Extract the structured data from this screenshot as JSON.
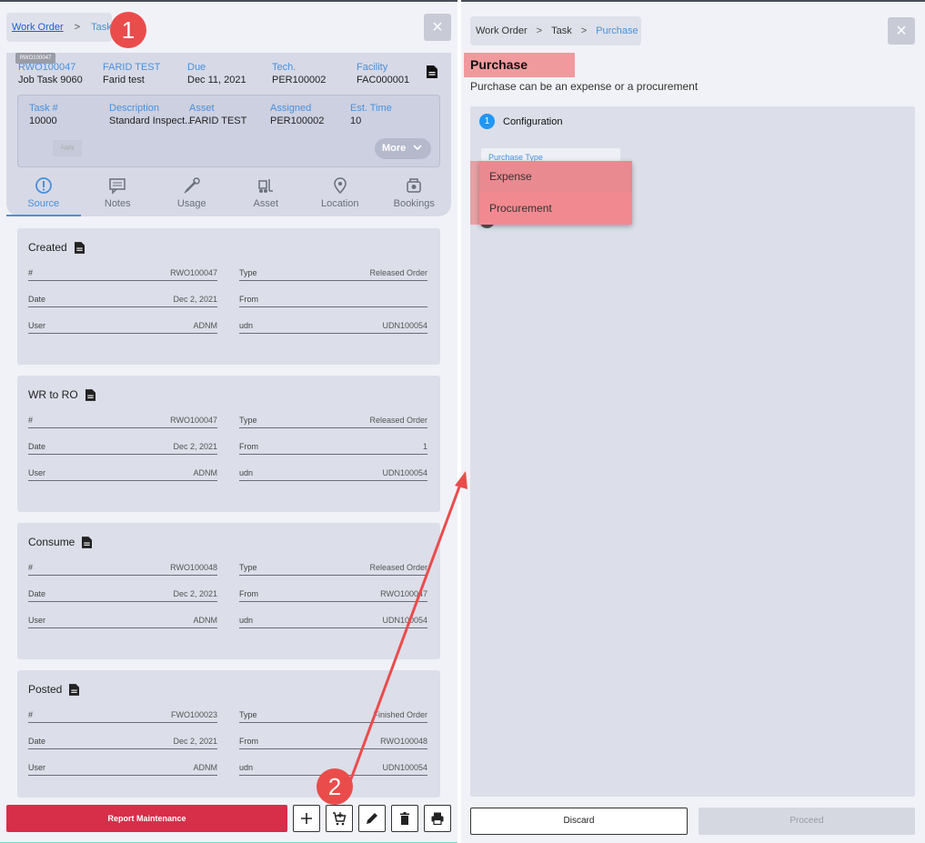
{
  "left": {
    "breadcrumb": {
      "work_order": "Work Order",
      "sep": ">",
      "task": "Task"
    },
    "close_label": "×",
    "small_tag": "RWO100047",
    "header": [
      {
        "key": "RWO100047",
        "value": "Job Task 9060"
      },
      {
        "key": "FARID TEST",
        "value": "Farid test"
      },
      {
        "key": "Due",
        "value": "Dec 11, 2021"
      },
      {
        "key": "Tech.",
        "value": "PER100002"
      },
      {
        "key": "Facility",
        "value": "FAC000001"
      }
    ],
    "inner": [
      {
        "key": "Task #",
        "value": "10000"
      },
      {
        "key": "Description",
        "value": "Standard Inspect..."
      },
      {
        "key": "Asset",
        "value": "FARID TEST"
      },
      {
        "key": "Assigned",
        "value": "PER100002"
      },
      {
        "key": "Est. Time",
        "value": "10"
      }
    ],
    "ghost_label": "Apply",
    "more_label": "More",
    "tabs": [
      {
        "label": "Source",
        "icon": "alert-circle-icon"
      },
      {
        "label": "Notes",
        "icon": "notes-icon"
      },
      {
        "label": "Usage",
        "icon": "usage-icon"
      },
      {
        "label": "Asset",
        "icon": "forklift-icon"
      },
      {
        "label": "Location",
        "icon": "location-pin-icon"
      },
      {
        "label": "Bookings",
        "icon": "bookings-icon"
      }
    ],
    "cards": [
      {
        "title": "Created",
        "rows": [
          {
            "k1": "#",
            "v1": "RWO100047",
            "k2": "Type",
            "v2": "Released Order"
          },
          {
            "k1": "Date",
            "v1": "Dec 2, 2021",
            "k2": "From",
            "v2": ""
          },
          {
            "k1": "User",
            "v1": "ADNM",
            "k2": "udn",
            "v2": "UDN100054"
          }
        ]
      },
      {
        "title": "WR to RO",
        "rows": [
          {
            "k1": "#",
            "v1": "RWO100047",
            "k2": "Type",
            "v2": "Released Order"
          },
          {
            "k1": "Date",
            "v1": "Dec 2, 2021",
            "k2": "From",
            "v2": "1"
          },
          {
            "k1": "User",
            "v1": "ADNM",
            "k2": "udn",
            "v2": "UDN100054"
          }
        ]
      },
      {
        "title": "Consume",
        "rows": [
          {
            "k1": "#",
            "v1": "RWO100048",
            "k2": "Type",
            "v2": "Released Order"
          },
          {
            "k1": "Date",
            "v1": "Dec 2, 2021",
            "k2": "From",
            "v2": "RWO100047"
          },
          {
            "k1": "User",
            "v1": "ADNM",
            "k2": "udn",
            "v2": "UDN100054"
          }
        ]
      },
      {
        "title": "Posted",
        "rows": [
          {
            "k1": "#",
            "v1": "FWO100023",
            "k2": "Type",
            "v2": "Finished Order"
          },
          {
            "k1": "Date",
            "v1": "Dec 2, 2021",
            "k2": "From",
            "v2": "RWO100048"
          },
          {
            "k1": "User",
            "v1": "ADNM",
            "k2": "udn",
            "v2": "UDN100054"
          }
        ]
      }
    ],
    "report_label": "Report Maintenance"
  },
  "right": {
    "breadcrumb": {
      "work_order": "Work Order",
      "sep": ">",
      "task": "Task",
      "purchase": "Purchase"
    },
    "close_label": "×",
    "title": "Purchase",
    "subtitle": "Purchase can be an expense or a procurement",
    "step_number": "1",
    "step_label": "Configuration",
    "background_field": "Purchase Type",
    "dropdown": [
      "Expense",
      "Procurement"
    ],
    "discard_label": "Discard",
    "proceed_label": "Proceed"
  },
  "annotations": {
    "one": "1",
    "two": "2"
  },
  "colors": {
    "accent": "#4a90d9",
    "report": "#d72e4a",
    "highlight": "#f09a9d",
    "annotation": "#ea4c4c"
  }
}
